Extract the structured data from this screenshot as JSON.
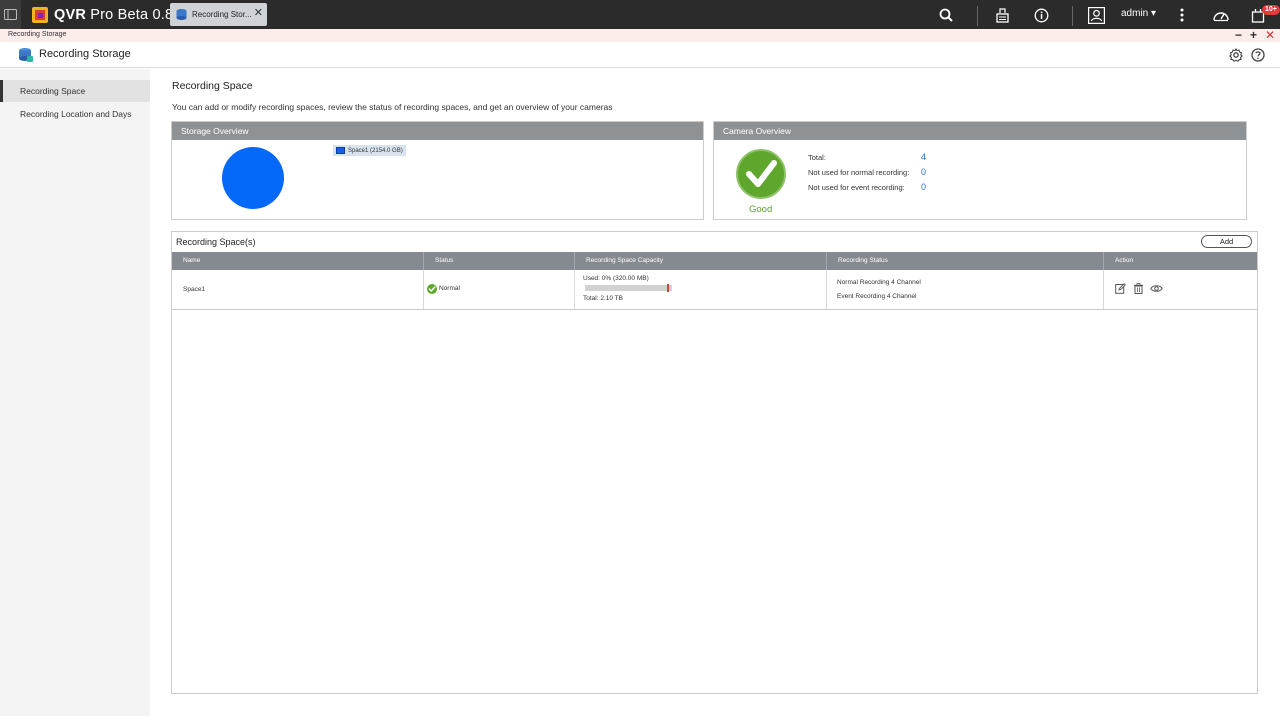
{
  "topbar": {
    "app_name_bold": "QVR",
    "app_name_rest": " Pro Beta 0.8",
    "tab_label": "Recording Stor...",
    "user": "admin",
    "badge": "10+"
  },
  "window": {
    "title": "Recording Storage"
  },
  "header": {
    "title": "Recording Storage"
  },
  "sidebar": {
    "items": [
      {
        "label": "Recording Space",
        "active": true
      },
      {
        "label": "Recording Location and Days",
        "active": false
      }
    ]
  },
  "main": {
    "title": "Recording Space",
    "description": "You can add or modify recording spaces, review the status of recording spaces, and get an overview of your cameras"
  },
  "storage_overview": {
    "title": "Storage Overview",
    "legend": "Space1 (2154.0 GB)",
    "color": "#0468f9"
  },
  "camera_overview": {
    "title": "Camera Overview",
    "status": "Good",
    "rows": [
      {
        "label": "Total:",
        "value": "4"
      },
      {
        "label": "Not used for normal recording:",
        "value": "0"
      },
      {
        "label": "Not used for event recording:",
        "value": "0"
      }
    ]
  },
  "recording_spaces": {
    "title": "Recording Space(s)",
    "add_label": "Add",
    "columns": [
      "Name",
      "Status",
      "Recording Space Capacity",
      "Recording Status",
      "Action"
    ],
    "rows": [
      {
        "name": "Space1",
        "status": "Normal",
        "used": "Used: 0% (320.00 MB)",
        "used_fraction": 0,
        "total": "Total: 2.10 TB",
        "normal_recording": "Normal Recording 4 Channel",
        "event_recording": "Event Recording 4 Channel"
      }
    ]
  }
}
